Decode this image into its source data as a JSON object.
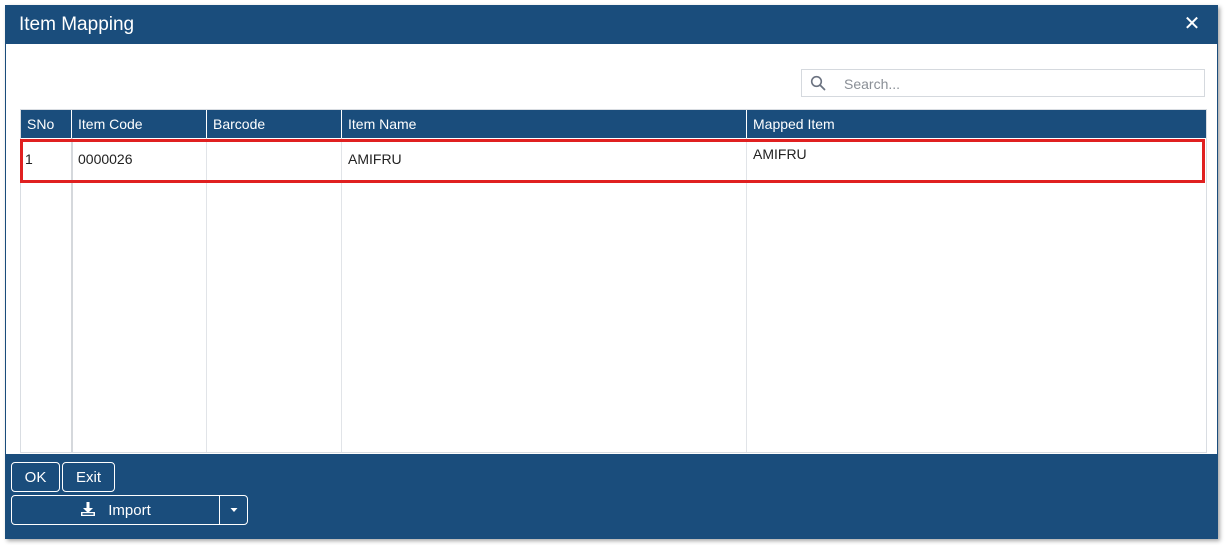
{
  "dialog": {
    "title": "Item Mapping",
    "close_glyph": "✕"
  },
  "search": {
    "placeholder": "Search...",
    "value": ""
  },
  "table": {
    "columns": [
      "SNo",
      "Item Code",
      "Barcode",
      "Item Name",
      "Mapped Item"
    ],
    "rows": [
      {
        "sno": "1",
        "item_code": "0000026",
        "barcode": "",
        "item_name": "AMIFRU",
        "mapped_item": "AMIFRU"
      }
    ],
    "highlight_color": "#e02020"
  },
  "footer": {
    "ok_label": "OK",
    "exit_label": "Exit",
    "import_label": "Import"
  },
  "colors": {
    "primary": "#1a4d7c",
    "highlight": "#e02020"
  }
}
